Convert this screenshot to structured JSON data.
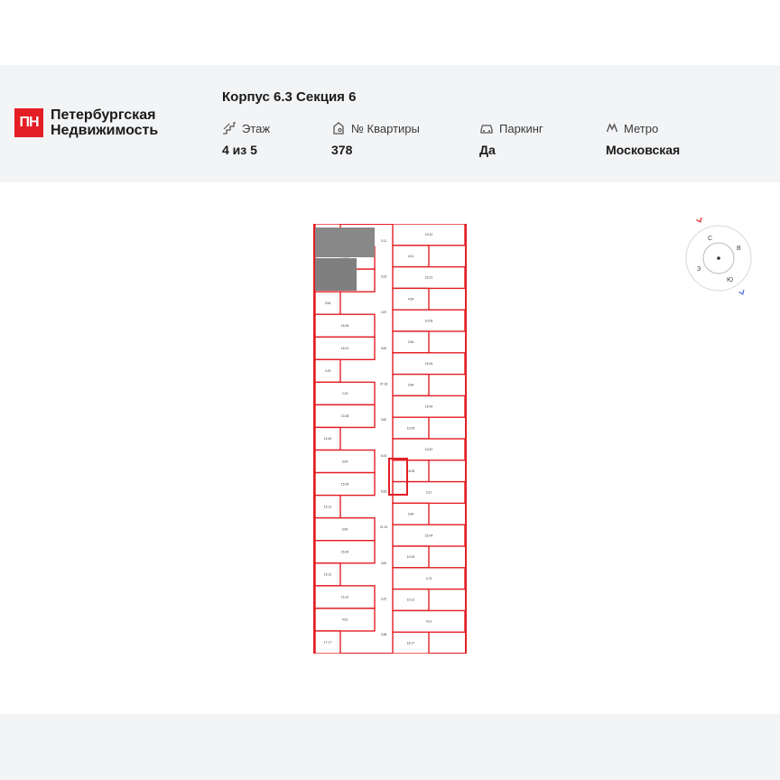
{
  "brand": {
    "logo_mark": "ПН",
    "name_line1": "Петербургская",
    "name_line2": "Недвижимость"
  },
  "header": {
    "title": "Корпус 6.3 Секция 6",
    "info": [
      {
        "icon": "stairs-icon",
        "label": "Этаж",
        "value": "4 из 5"
      },
      {
        "icon": "apartment-icon",
        "label": "№ Квартиры",
        "value": "378"
      },
      {
        "icon": "car-icon",
        "label": "Паркинг",
        "value": "Да"
      },
      {
        "icon": "metro-icon",
        "label": "Метро",
        "value": "Московская"
      }
    ]
  },
  "compass": {
    "n": "С",
    "e": "В",
    "s": "Ю",
    "w": "З"
  },
  "colors": {
    "accent": "#e31e24",
    "wall": "#e31e24",
    "highlight": "#7f7f7f",
    "header_bg": "#f3f4f6"
  },
  "floorplan": {
    "left_areas": [
      "4.83",
      "12.01",
      "15.12",
      "3.54",
      "15.39",
      "16.01",
      "2.23",
      "2.23",
      "13.08",
      "14.40",
      "3.54",
      "15.05",
      "15.12",
      "3.54",
      "15.09",
      "15.12",
      "15.12",
      "4.51",
      "17.17"
    ],
    "right_areas": [
      "19.22",
      "4.01",
      "15.21",
      "4.54",
      "10.09",
      "2.84",
      "15.04",
      "3.84",
      "15.04",
      "10.09",
      "10.87",
      "18.05",
      "3.21",
      "3.84",
      "15.04",
      "10.09",
      "4.73",
      "15.12",
      "4.01",
      "18.17"
    ],
    "corridor_areas": [
      "3.11",
      "3.23",
      "2.87",
      "3.82",
      "37.33",
      "3.82",
      "6.43",
      "5.83",
      "21.31",
      "3.82",
      "3.22",
      "3.58"
    ]
  }
}
